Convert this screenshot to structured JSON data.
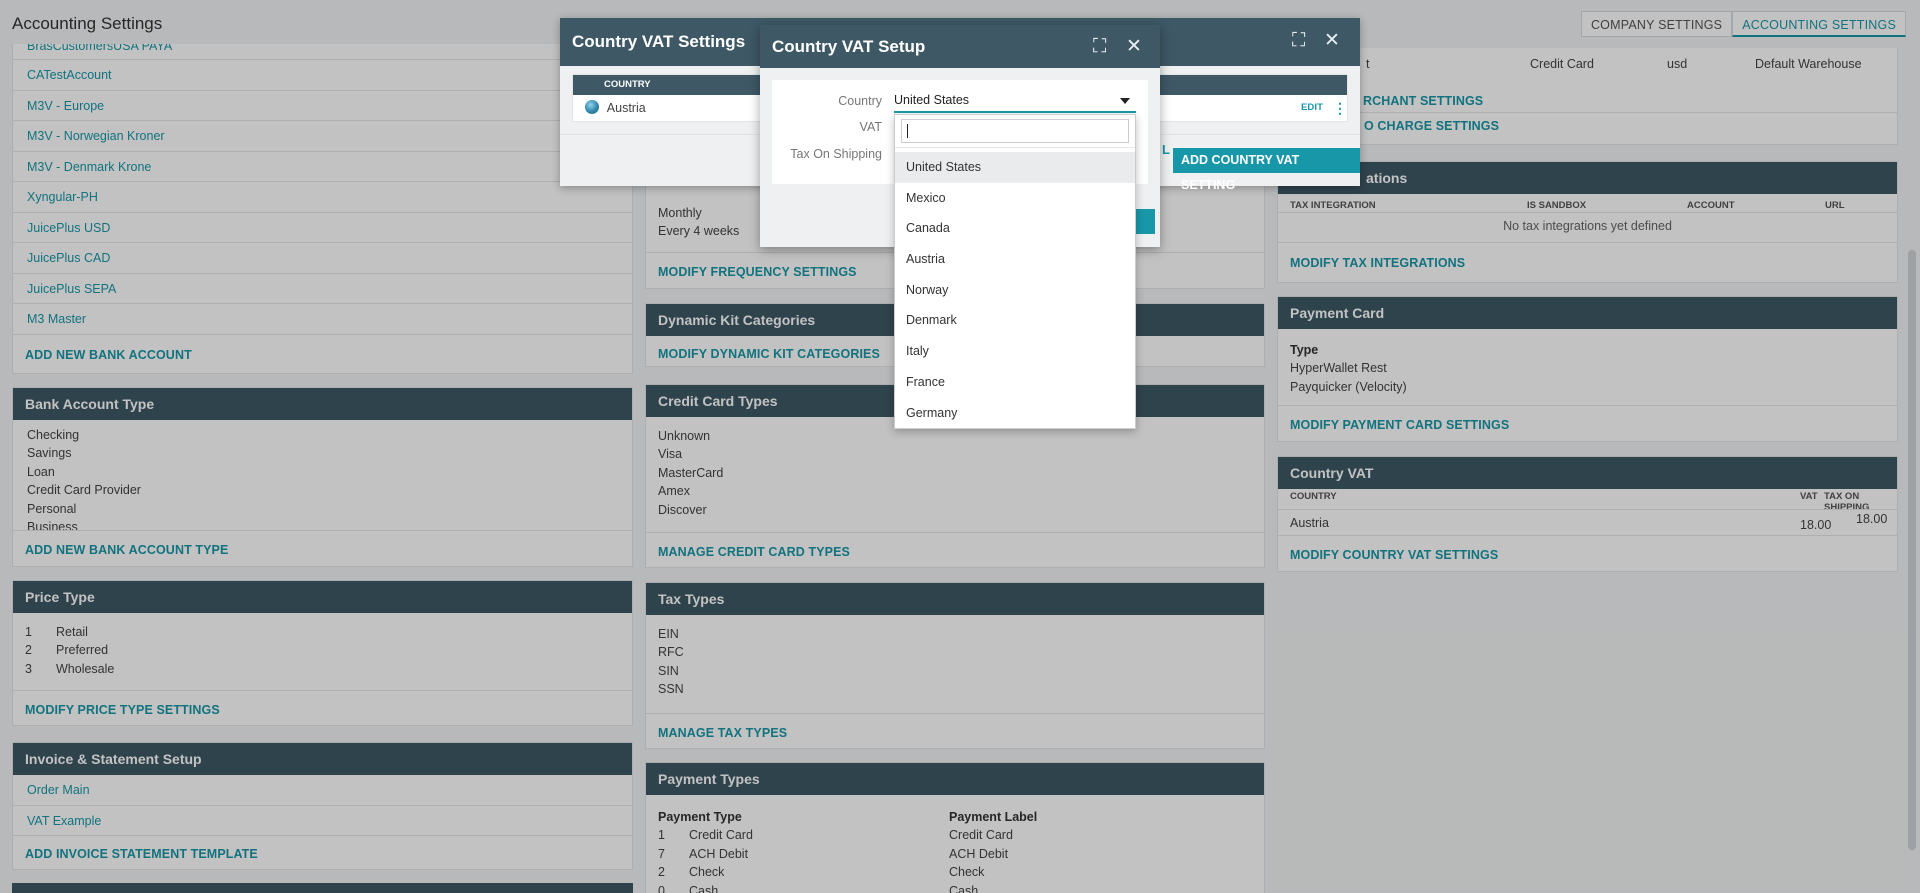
{
  "app": {
    "title": "Accounting Settings"
  },
  "top_tabs": [
    {
      "label": "COMPANY SETTINGS",
      "active": false
    },
    {
      "label": "ACCOUNTING SETTINGS",
      "active": true
    }
  ],
  "bank_accounts": {
    "partial_top": "BrasCustomersUSA PAYA",
    "items": [
      "CATestAccount",
      "M3V - Europe",
      "M3V - Norwegian Kroner",
      "M3V - Denmark Krone",
      "Xyngular-PH",
      "JuicePlus USD",
      "JuicePlus CAD",
      "JuicePlus SEPA",
      "M3 Master"
    ],
    "add_label": "ADD NEW BANK ACCOUNT"
  },
  "bank_account_type": {
    "title": "Bank Account Type",
    "items": [
      "Checking",
      "Savings",
      "Loan",
      "Credit Card Provider",
      "Personal",
      "Business"
    ],
    "add_label": "ADD NEW BANK ACCOUNT TYPE"
  },
  "price_type": {
    "title": "Price Type",
    "rows": [
      {
        "id": "1",
        "name": "Retail"
      },
      {
        "id": "2",
        "name": "Preferred"
      },
      {
        "id": "3",
        "name": "Wholesale"
      }
    ],
    "modify_label": "MODIFY PRICE TYPE SETTINGS"
  },
  "invoice_setup": {
    "title": "Invoice & Statement Setup",
    "items": [
      "Order Main",
      "VAT Example"
    ],
    "add_label": "ADD INVOICE STATEMENT TEMPLATE"
  },
  "frequency": {
    "items": [
      "Monthly",
      "Every 4 weeks"
    ],
    "modify_label": "MODIFY FREQUENCY SETTINGS"
  },
  "dynamic_kit": {
    "title": "Dynamic Kit Categories",
    "modify_label": "MODIFY DYNAMIC KIT CATEGORIES"
  },
  "credit_card_types": {
    "title": "Credit Card Types",
    "items": [
      "Unknown",
      "Visa",
      "MasterCard",
      "Amex",
      "Discover"
    ],
    "manage_label": "MANAGE CREDIT CARD TYPES"
  },
  "tax_types": {
    "title": "Tax Types",
    "items": [
      "EIN",
      "RFC",
      "SIN",
      "SSN"
    ],
    "manage_label": "MANAGE TAX TYPES"
  },
  "payment_types": {
    "title": "Payment Types",
    "col_type": "Payment Type",
    "col_label": "Payment Label",
    "rows": [
      {
        "id": "1",
        "type": "Credit Card",
        "label": "Credit Card"
      },
      {
        "id": "7",
        "type": "ACH Debit",
        "label": "ACH Debit"
      },
      {
        "id": "2",
        "type": "Check",
        "label": "Check"
      },
      {
        "id": "0",
        "type": "Cash",
        "label": "Cash"
      }
    ]
  },
  "merchant": {
    "row_partial": "t",
    "row_payment": "Credit Card",
    "row_currency": "usd",
    "row_warehouse": "Default Warehouse",
    "merchant_link_partial": "RCHANT SETTINGS",
    "charge_link_partial": "O CHARGE SETTINGS"
  },
  "tax_integrations": {
    "title_partial": "ations",
    "cols": [
      "TAX INTEGRATION",
      "IS SANDBOX",
      "ACCOUNT",
      "URL"
    ],
    "empty_text": "No tax integrations yet defined",
    "modify_label": "MODIFY TAX INTEGRATIONS"
  },
  "payment_card": {
    "title": "Payment Card",
    "type_label": "Type",
    "items": [
      "HyperWallet Rest",
      "Payquicker (Velocity)"
    ],
    "modify_label": "MODIFY PAYMENT CARD SETTINGS"
  },
  "country_vat": {
    "title": "Country VAT",
    "cols": [
      "COUNTRY",
      "VAT",
      "TAX ON SHIPPING"
    ],
    "rows": [
      {
        "country": "Austria",
        "vat": "18.00",
        "shipping": "18.00"
      }
    ],
    "modify_label": "MODIFY COUNTRY VAT SETTINGS"
  },
  "vat_settings_modal": {
    "title": "Country VAT Settings",
    "col_country": "COUNTRY",
    "row_country": "Austria",
    "edit_label": "EDIT",
    "add_label": "ADD COUNTRY VAT SETTING",
    "partial_left": "L"
  },
  "vat_setup_modal": {
    "title": "Country VAT Setup",
    "country_label": "Country",
    "vat_label": "VAT",
    "shipping_label": "Tax On Shipping",
    "selected_country": "United States",
    "search_value": "",
    "options": [
      "United States",
      "Mexico",
      "Canada",
      "Austria",
      "Norway",
      "Denmark",
      "Italy",
      "France",
      "Germany"
    ]
  },
  "colors": {
    "header": "#3e5866",
    "accent": "#1897a8"
  },
  "icons": [
    "globe-icon",
    "maximize-icon",
    "close-icon",
    "kebab-icon",
    "caret-down-icon"
  ]
}
